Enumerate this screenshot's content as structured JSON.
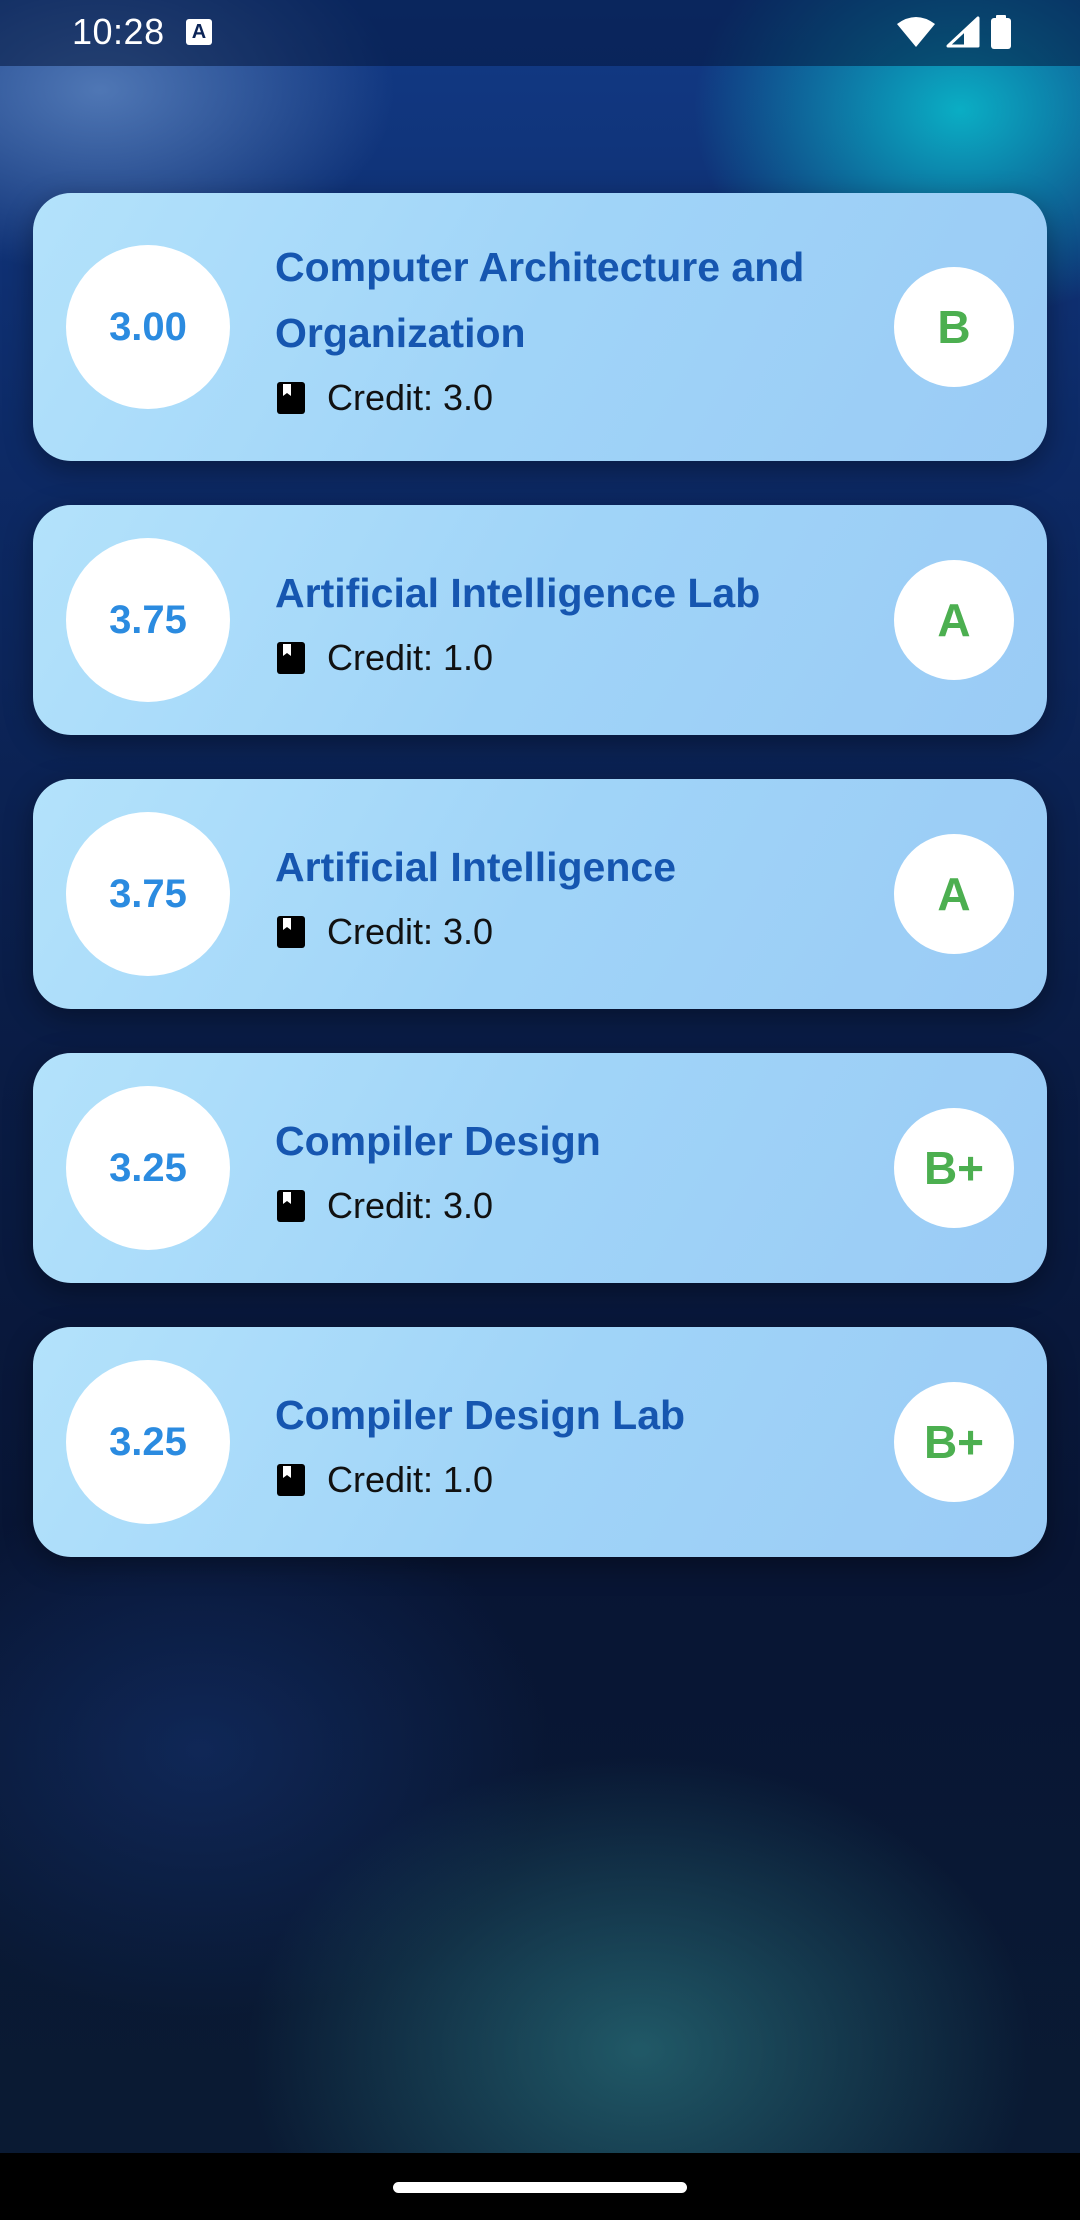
{
  "status_bar": {
    "time": "10:28",
    "icons": [
      "a-notification-icon",
      "wifi-icon",
      "cellular-signal-icon",
      "battery-icon"
    ]
  },
  "courses": [
    {
      "gpa": "3.00",
      "title": "Computer Architecture and Organization",
      "credit": "Credit: 3.0",
      "grade": "B"
    },
    {
      "gpa": "3.75",
      "title": "Artificial Intelligence Lab",
      "credit": "Credit: 1.0",
      "grade": "A"
    },
    {
      "gpa": "3.75",
      "title": "Artificial Intelligence",
      "credit": "Credit: 3.0",
      "grade": "A"
    },
    {
      "gpa": "3.25",
      "title": "Compiler Design",
      "credit": "Credit: 3.0",
      "grade": "B+"
    },
    {
      "gpa": "3.25",
      "title": "Compiler Design Lab",
      "credit": "Credit: 1.0",
      "grade": "B+"
    }
  ],
  "colors": {
    "gpa_text": "#2b8be0",
    "grade_text": "#4caf50",
    "course_title": "#1656b0",
    "card_background": "#a6d8f8"
  }
}
